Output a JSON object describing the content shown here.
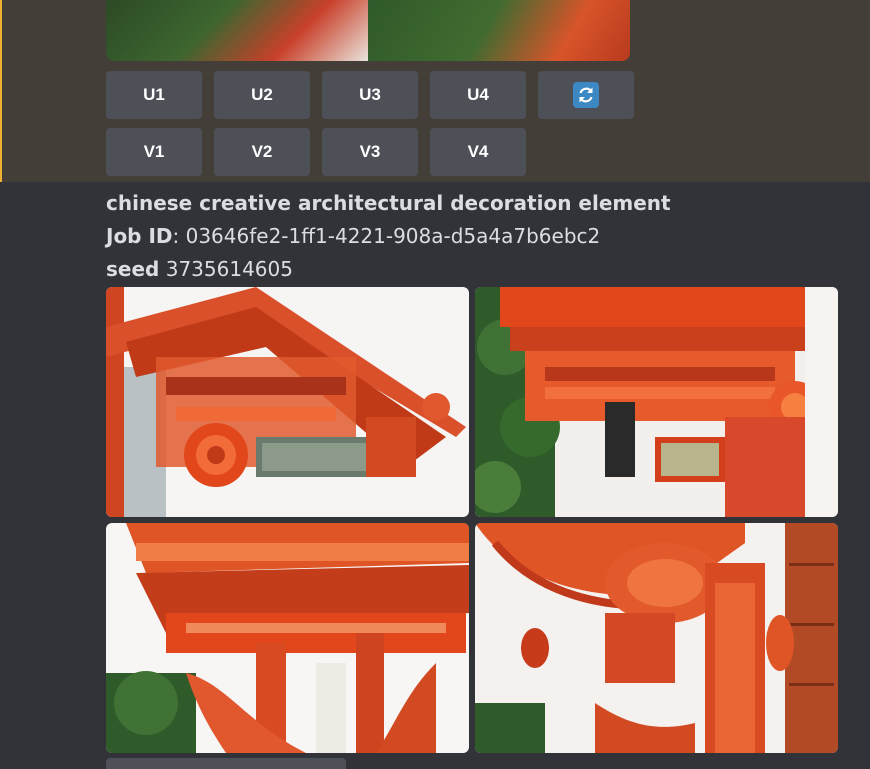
{
  "previous_message": {
    "buttons_row1": [
      "U1",
      "U2",
      "U3",
      "U4"
    ],
    "refresh_icon": "refresh-icon",
    "buttons_row2": [
      "V1",
      "V2",
      "V3",
      "V4"
    ]
  },
  "current_message": {
    "prompt": "chinese creative architectural decoration element",
    "job_id_label": "Job ID",
    "job_id_value": ": 03646fe2-1ff1-4221-908a-d5a4a7b6ebc2",
    "seed_label": "seed",
    "seed_value": " 3735614605"
  },
  "colors": {
    "background": "#313338",
    "highlight_background": "#443e39",
    "button": "#4e5058",
    "vermilion": "#e2471c",
    "foliage": "#2f5a2a"
  }
}
